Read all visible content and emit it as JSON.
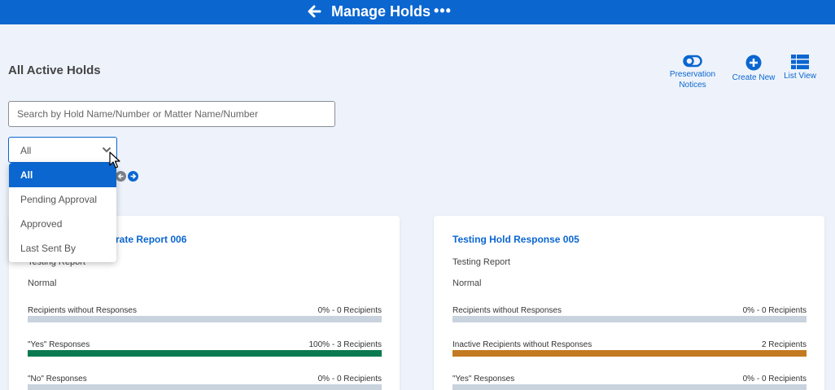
{
  "header": {
    "title": "Manage Holds",
    "more_label": "•••"
  },
  "page": {
    "title": "All Active Holds"
  },
  "actions": {
    "preservation_notices": "Preservation Notices",
    "create_new": "Create New",
    "list_view": "List View"
  },
  "search": {
    "placeholder": "Search by Hold Name/Number or Matter Name/Number",
    "value": ""
  },
  "filter": {
    "selected": "All",
    "options": [
      "All",
      "Pending Approval",
      "Approved",
      "Last Sent By"
    ]
  },
  "colors": {
    "brand": "#0b66d0",
    "green": "#0c7a50",
    "orange": "#c47a22",
    "track": "#c9d3de"
  },
  "cards": [
    {
      "title": "e rate Report 006",
      "type": "Testing Report",
      "priority": "Normal",
      "metrics": [
        {
          "label": "Recipients without Responses",
          "value": "0% - 0 Recipients",
          "fill": 0,
          "color": "#c9d3de"
        },
        {
          "label": "\"Yes\" Responses",
          "value": "100% - 3 Recipients",
          "fill": 1,
          "color": "#0c7a50"
        },
        {
          "label": "\"No\" Responses",
          "value": "0% - 0 Recipients",
          "fill": 0,
          "color": "#c9d3de"
        }
      ]
    },
    {
      "title": "Testing Hold Response 005",
      "type": "Testing Report",
      "priority": "Normal",
      "metrics": [
        {
          "label": "Recipients without Responses",
          "value": "0% - 0 Recipients",
          "fill": 0,
          "color": "#c9d3de"
        },
        {
          "label": "Inactive Recipients without Responses",
          "value": "2 Recipients",
          "fill": 1,
          "color": "#c47a22"
        },
        {
          "label": "\"Yes\" Responses",
          "value": "0% - 0 Recipients",
          "fill": 0,
          "color": "#c9d3de"
        }
      ]
    }
  ]
}
